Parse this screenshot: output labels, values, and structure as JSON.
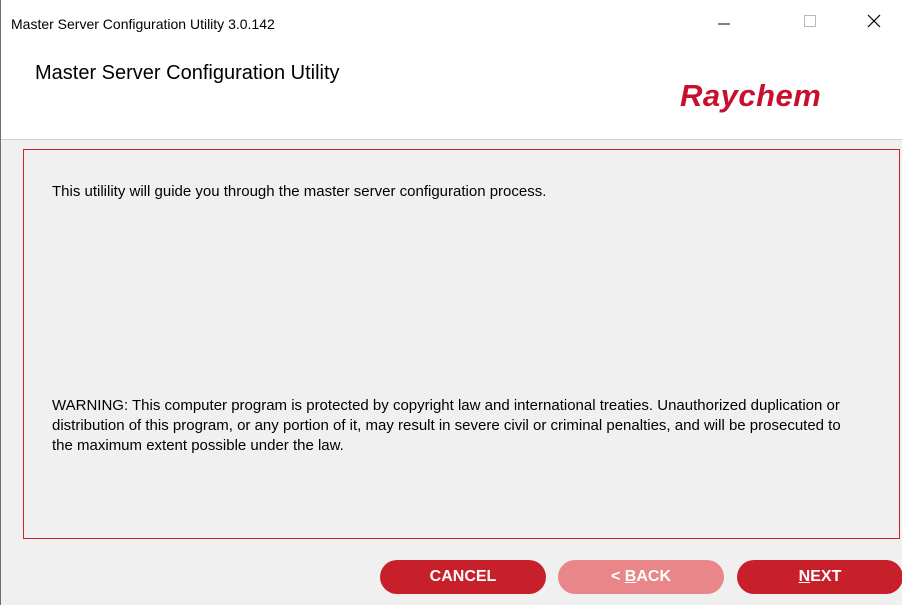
{
  "window": {
    "title": "Master Server Configuration Utility 3.0.142",
    "minimize_glyph": "—",
    "maximize_glyph": "☐",
    "close_glyph": "✕"
  },
  "header": {
    "heading": "Master Server Configuration Utility",
    "logo_text": "Raychem",
    "logo_color": "#c8102e"
  },
  "content": {
    "intro": "This utilility will guide you through the master server configuration process.",
    "warning": "WARNING: This computer program is protected by copyright law and international treaties. Unauthorized duplication or distribution of this program, or any portion of it, may result in severe civil or criminal penalties, and will be prosecuted to the maximum extent possible under the law."
  },
  "buttons": {
    "cancel": "CANCEL",
    "back_prefix": "< ",
    "back_accel": "B",
    "back_rest": "ACK",
    "next_accel": "N",
    "next_rest": "EXT",
    "primary_color": "#c8202a",
    "disabled_color": "#e8868a"
  }
}
